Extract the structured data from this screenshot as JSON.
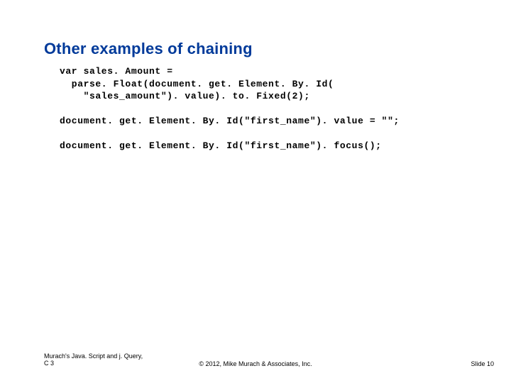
{
  "title": "Other examples of chaining",
  "code": "var sales. Amount =\n  parse. Float(document. get. Element. By. Id(\n    \"sales_amount\"). value). to. Fixed(2);\n\ndocument. get. Element. By. Id(\"first_name\"). value = \"\";\n\ndocument. get. Element. By. Id(\"first_name\"). focus();",
  "footer": {
    "left_line1": "Murach's Java. Script and j. Query,",
    "left_line2": "C 3",
    "center": "© 2012, Mike Murach & Associates, Inc.",
    "right": "Slide 10"
  }
}
